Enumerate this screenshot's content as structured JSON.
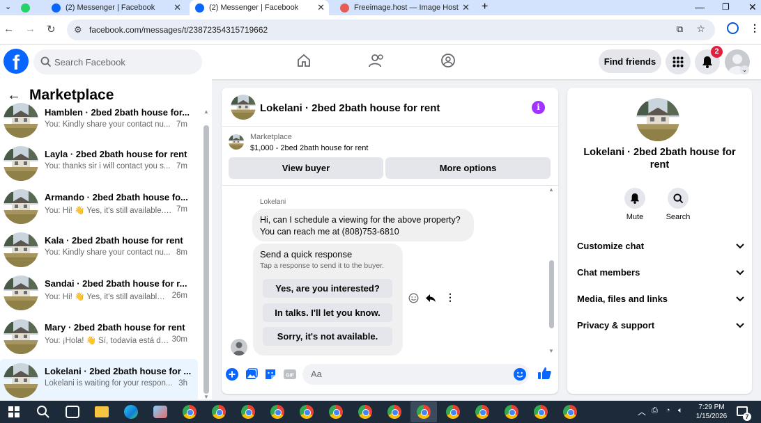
{
  "browser": {
    "tabs": [
      {
        "label": "",
        "icon": "whatsapp-icon",
        "color": "#25d366"
      },
      {
        "label": "(2) Messenger | Facebook",
        "icon": "facebook-icon",
        "color": "#0866ff"
      },
      {
        "label": "(2) Messenger | Facebook",
        "icon": "facebook-icon",
        "color": "#0866ff",
        "active": true
      },
      {
        "label": "Freeimage.host — Image Hosti",
        "icon": "freeimage-icon",
        "color": "#e85c55"
      }
    ],
    "url": "facebook.com/messages/t/23872354315719662"
  },
  "facebook": {
    "search_placeholder": "Search Facebook",
    "find_friends": "Find friends",
    "notification_count": "2"
  },
  "sidebar": {
    "title": "Marketplace",
    "conversations": [
      {
        "name": "Hamblen · 2bed 2bath house for...",
        "snippet": "You: Kindly share your contact nu...",
        "time": "7m"
      },
      {
        "name": "Layla · 2bed 2bath house for rent",
        "snippet": "You: thanks sir i will contact you s...",
        "time": "7m"
      },
      {
        "name": "Armando · 2bed 2bath house fo...",
        "snippet": "You: Hi! 👋 Yes, it's still available. T...",
        "time": "7m"
      },
      {
        "name": "Kala · 2bed 2bath house for rent",
        "snippet": "You: Kindly share your contact nu...",
        "time": "8m"
      },
      {
        "name": "Sandai · 2bed 2bath house for r...",
        "snippet": "You: Hi! 👋 Yes, it's still available. ...",
        "time": "26m"
      },
      {
        "name": "Mary · 2bed 2bath house for rent",
        "snippet": "You: ¡Hola! 👋 Sí, todavía está dis...",
        "time": "30m"
      },
      {
        "name": "Lokelani · 2bed 2bath house for ...",
        "snippet": "Lokelani is waiting for your respon...",
        "time": "3h"
      }
    ]
  },
  "chat": {
    "title": "Lokelani · 2bed 2bath house for rent",
    "listing_category": "Marketplace",
    "listing_price": "$1,000 - 2bed 2bath house for rent",
    "view_buyer": "View buyer",
    "more_options": "More options",
    "sender": "Lokelani",
    "message_line1": "Hi, can I schedule a viewing for the above property?",
    "message_line2": "You can reach me at (808)753-6810",
    "quick_title": "Send a quick response",
    "quick_subtitle": "Tap a response to send it to the buyer.",
    "quick_replies": [
      "Yes, are you interested?",
      "In talks. I'll let you know.",
      "Sorry, it's not available."
    ],
    "composer_placeholder": "Aa"
  },
  "details": {
    "title": "Lokelani · 2bed 2bath house for rent",
    "mute": "Mute",
    "search": "Search",
    "sections": [
      "Customize chat",
      "Chat members",
      "Media, files and links",
      "Privacy & support"
    ]
  },
  "taskbar": {
    "time": "7:29 PM",
    "date": "1/15/2026",
    "notifications": "7"
  },
  "colors": {
    "facebook_blue": "#0866ff",
    "messenger_blue": "#0a7cff",
    "info_purple": "#a033ff",
    "badge_red": "#e41e3f"
  }
}
